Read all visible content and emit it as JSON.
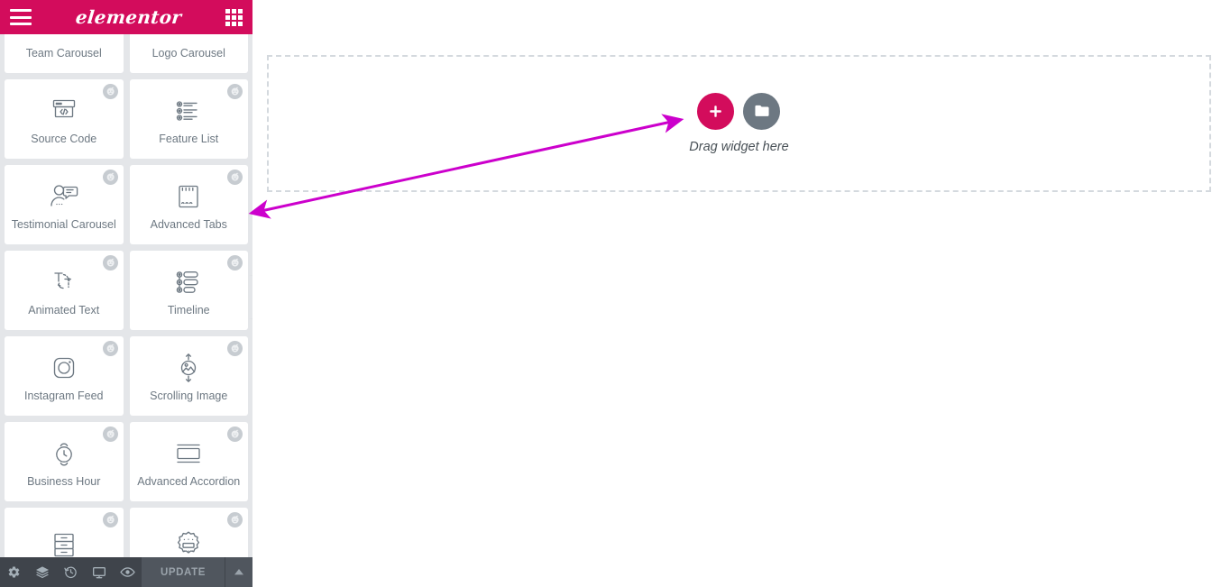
{
  "panel": {
    "header": {
      "menu_icon": "hamburger-icon",
      "logo_text": "elementor",
      "widgets_icon": "grid-icon"
    },
    "widgets": [
      {
        "label": "Team Carousel",
        "icon": "team-carousel-icon",
        "pro": true,
        "clipped": true
      },
      {
        "label": "Logo Carousel",
        "icon": "logo-carousel-icon",
        "pro": true,
        "clipped": true
      },
      {
        "label": "Source Code",
        "icon": "source-code-icon",
        "pro": true,
        "clipped": false
      },
      {
        "label": "Feature List",
        "icon": "feature-list-icon",
        "pro": true,
        "clipped": false
      },
      {
        "label": "Testimonial Carousel",
        "icon": "testimonial-carousel-icon",
        "pro": true,
        "clipped": false
      },
      {
        "label": "Advanced Tabs",
        "icon": "advanced-tabs-icon",
        "pro": true,
        "clipped": false
      },
      {
        "label": "Animated Text",
        "icon": "animated-text-icon",
        "pro": true,
        "clipped": false
      },
      {
        "label": "Timeline",
        "icon": "timeline-icon",
        "pro": true,
        "clipped": false
      },
      {
        "label": "Instagram Feed",
        "icon": "instagram-feed-icon",
        "pro": true,
        "clipped": false
      },
      {
        "label": "Scrolling Image",
        "icon": "scrolling-image-icon",
        "pro": true,
        "clipped": false
      },
      {
        "label": "Business Hour",
        "icon": "business-hour-icon",
        "pro": true,
        "clipped": false
      },
      {
        "label": "Advanced Accordion",
        "icon": "advanced-accordion-icon",
        "pro": true,
        "clipped": false
      },
      {
        "label": "",
        "icon": "stacked-list-icon",
        "pro": true,
        "clipped": true
      },
      {
        "label": "",
        "icon": "badge-ribbon-icon",
        "pro": true,
        "clipped": true
      }
    ],
    "collapse_tab": {
      "icon": "chevron-left-icon"
    }
  },
  "bottom_bar": {
    "icons": [
      {
        "name": "settings-gear-icon",
        "title": "Settings"
      },
      {
        "name": "navigator-layers-icon",
        "title": "Navigator"
      },
      {
        "name": "history-clock-icon",
        "title": "History"
      },
      {
        "name": "responsive-monitor-icon",
        "title": "Responsive Mode"
      },
      {
        "name": "preview-eye-icon",
        "title": "Preview Changes"
      }
    ],
    "update_label": "UPDATE",
    "update_caret_icon": "chevron-up-icon"
  },
  "canvas": {
    "drop_zone": {
      "add_section_label": "+",
      "add_template_icon": "folder-icon",
      "hint_text": "Drag widget here"
    }
  },
  "annotation": {
    "arrow_color": "#CC00CC",
    "type": "double-headed-arrow",
    "from": "collapse-tab",
    "to": "add-section-button"
  },
  "colors": {
    "brand_pink": "#D30C5C",
    "panel_bg": "#E4E6E9",
    "toolbar_dark": "#3F444B",
    "widget_text": "#6D7882",
    "dashed_border": "#D4D9DE",
    "annotation_magenta": "#CC00CC"
  }
}
